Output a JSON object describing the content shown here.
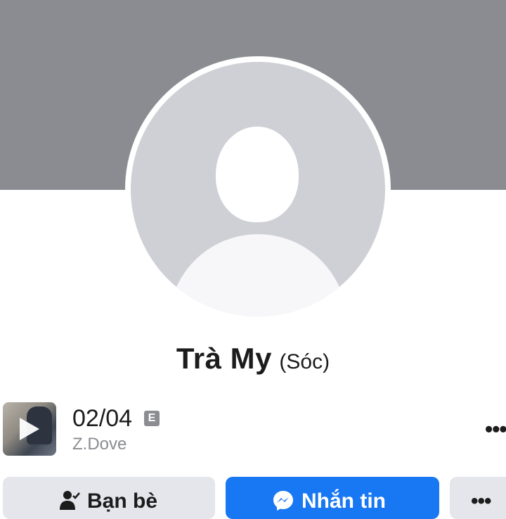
{
  "profile": {
    "name": "Trà My",
    "alternate_name": "(Sóc)"
  },
  "profile_music": {
    "title": "02/04",
    "explicit_badge": "E",
    "artist": "Z.Dove"
  },
  "actions": {
    "friends_label": "Bạn bè",
    "message_label": "Nhắn tin",
    "more_label": "•••"
  },
  "menu": {
    "more_dots": "•••"
  },
  "colors": {
    "cover": "#8a8c91",
    "avatar_bg": "#cfd0d5",
    "primary": "#1877f2",
    "secondary_button": "#e4e6eb"
  },
  "icons": {
    "friends": "person-check-icon",
    "message": "messenger-icon",
    "play": "play-icon"
  }
}
